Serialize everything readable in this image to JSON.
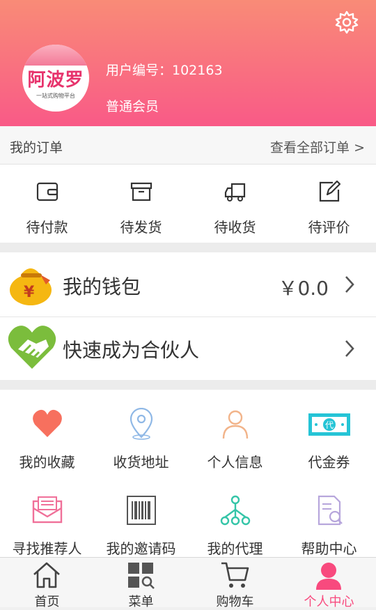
{
  "header": {
    "avatar_brand": "阿波罗",
    "avatar_subtitle": "一站式购物平台",
    "user_id": "用户编号：102163",
    "member_level": "普通会员"
  },
  "orders": {
    "title": "我的订单",
    "view_all": "查看全部订单 >",
    "items": [
      {
        "label": "待付款",
        "icon": "wallet-icon"
      },
      {
        "label": "待发货",
        "icon": "box-icon"
      },
      {
        "label": "待收货",
        "icon": "truck-icon"
      },
      {
        "label": "待评价",
        "icon": "edit-icon"
      }
    ]
  },
  "wallet": {
    "label": "我的钱包",
    "amount": "￥0.0"
  },
  "partner": {
    "label": "快速成为合伙人"
  },
  "grid": [
    {
      "label": "我的收藏",
      "icon": "heart-icon",
      "color": "#f7705e"
    },
    {
      "label": "收货地址",
      "icon": "location-icon",
      "color": "#8fb8e6"
    },
    {
      "label": "个人信息",
      "icon": "person-icon",
      "color": "#f2b48a"
    },
    {
      "label": "代金券",
      "icon": "voucher-icon",
      "color": "#25c4d6"
    },
    {
      "label": "寻找推荐人",
      "icon": "mail-icon",
      "color": "#f07099"
    },
    {
      "label": "我的邀请码",
      "icon": "barcode-icon",
      "color": "#555555"
    },
    {
      "label": "我的代理",
      "icon": "network-icon",
      "color": "#35c5a8"
    },
    {
      "label": "帮助中心",
      "icon": "help-doc-icon",
      "color": "#b7a6dc"
    }
  ],
  "bottom_nav": [
    {
      "label": "首页",
      "icon": "home-icon"
    },
    {
      "label": "菜单",
      "icon": "menu-grid-icon"
    },
    {
      "label": "购物车",
      "icon": "cart-icon"
    },
    {
      "label": "个人中心",
      "icon": "user-icon",
      "active": true
    }
  ],
  "colors": {
    "accent": "#f84a7e",
    "header_top": "#f98b77",
    "header_bottom": "#f95a87"
  }
}
